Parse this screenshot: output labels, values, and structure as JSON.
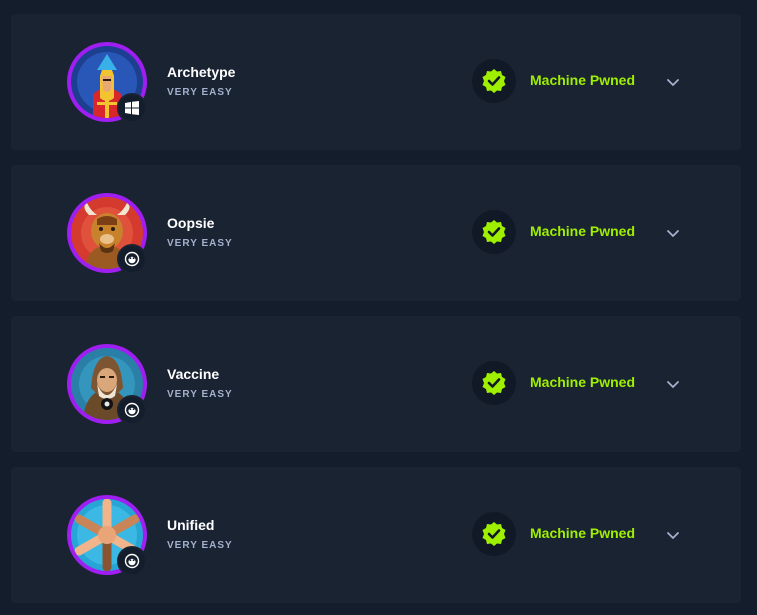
{
  "machines": [
    {
      "name": "Archetype",
      "difficulty": "VERY EASY",
      "os": "windows-icon",
      "status": "Machine Pwned"
    },
    {
      "name": "Oopsie",
      "difficulty": "VERY EASY",
      "os": "linux-icon",
      "status": "Machine Pwned"
    },
    {
      "name": "Vaccine",
      "difficulty": "VERY EASY",
      "os": "linux-icon",
      "status": "Machine Pwned"
    },
    {
      "name": "Unified",
      "difficulty": "VERY EASY",
      "os": "linux-icon",
      "status": "Machine Pwned"
    }
  ],
  "colors": {
    "background": "#141d2b",
    "card": "#1a2332",
    "accent_green": "#9fef00",
    "avatar_ring": "#9f1ff2",
    "muted_text": "#a4b1cd"
  }
}
